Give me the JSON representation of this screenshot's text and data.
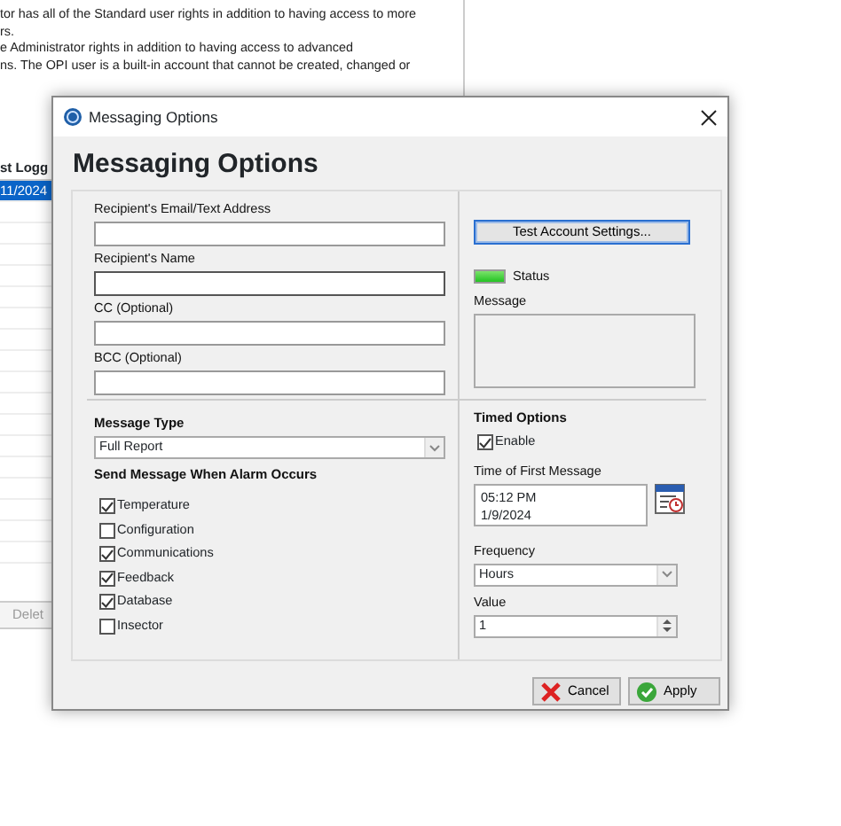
{
  "background_doc": {
    "lines": [
      "tor has all of the Standard user rights in addition to having access to more",
      "rs.",
      "e Administrator rights in addition to having access to advanced",
      "ns.  The OPI user is a built-in account that cannot be created, changed or"
    ]
  },
  "background_table": {
    "header": "st Logg",
    "rows": [
      {
        "cell": "11/2024",
        "selected": true
      }
    ],
    "delete_button": {
      "label": "Delet",
      "disabled": true
    }
  },
  "dialog": {
    "title": "Messaging Options",
    "heading": "Messaging Options",
    "fields": [
      {
        "label": "Recipient's Email/Text Address",
        "focused": false
      },
      {
        "label": "Recipient's Name",
        "focused": true
      },
      {
        "label": "CC (Optional)",
        "focused": false
      },
      {
        "label": "BCC (Optional)",
        "focused": false
      }
    ],
    "test_button": "Test Account Settings...",
    "status": {
      "label": "Status",
      "on": true
    },
    "message_label": "Message",
    "message_type": {
      "label": "Message Type",
      "value": "Full Report"
    },
    "alarm_heading": "Send Message When Alarm Occurs",
    "alarms": [
      {
        "label": "Temperature",
        "checked": true
      },
      {
        "label": "Configuration",
        "checked": false
      },
      {
        "label": "Communications",
        "checked": true
      },
      {
        "label": "Feedback",
        "checked": true
      },
      {
        "label": "Database",
        "checked": true
      },
      {
        "label": "Insector",
        "checked": false
      }
    ],
    "timed": {
      "heading": "Timed Options",
      "enable": {
        "label": "Enable",
        "checked": true
      },
      "time_label": "Time of First Message",
      "time": "05:12 PM",
      "date": "1/9/2024",
      "frequency_label": "Frequency",
      "frequency": "Hours",
      "value_label": "Value",
      "value": "1"
    },
    "buttons": [
      {
        "kind": "cancel",
        "label": "Cancel"
      },
      {
        "kind": "apply",
        "label": "Apply"
      }
    ]
  }
}
